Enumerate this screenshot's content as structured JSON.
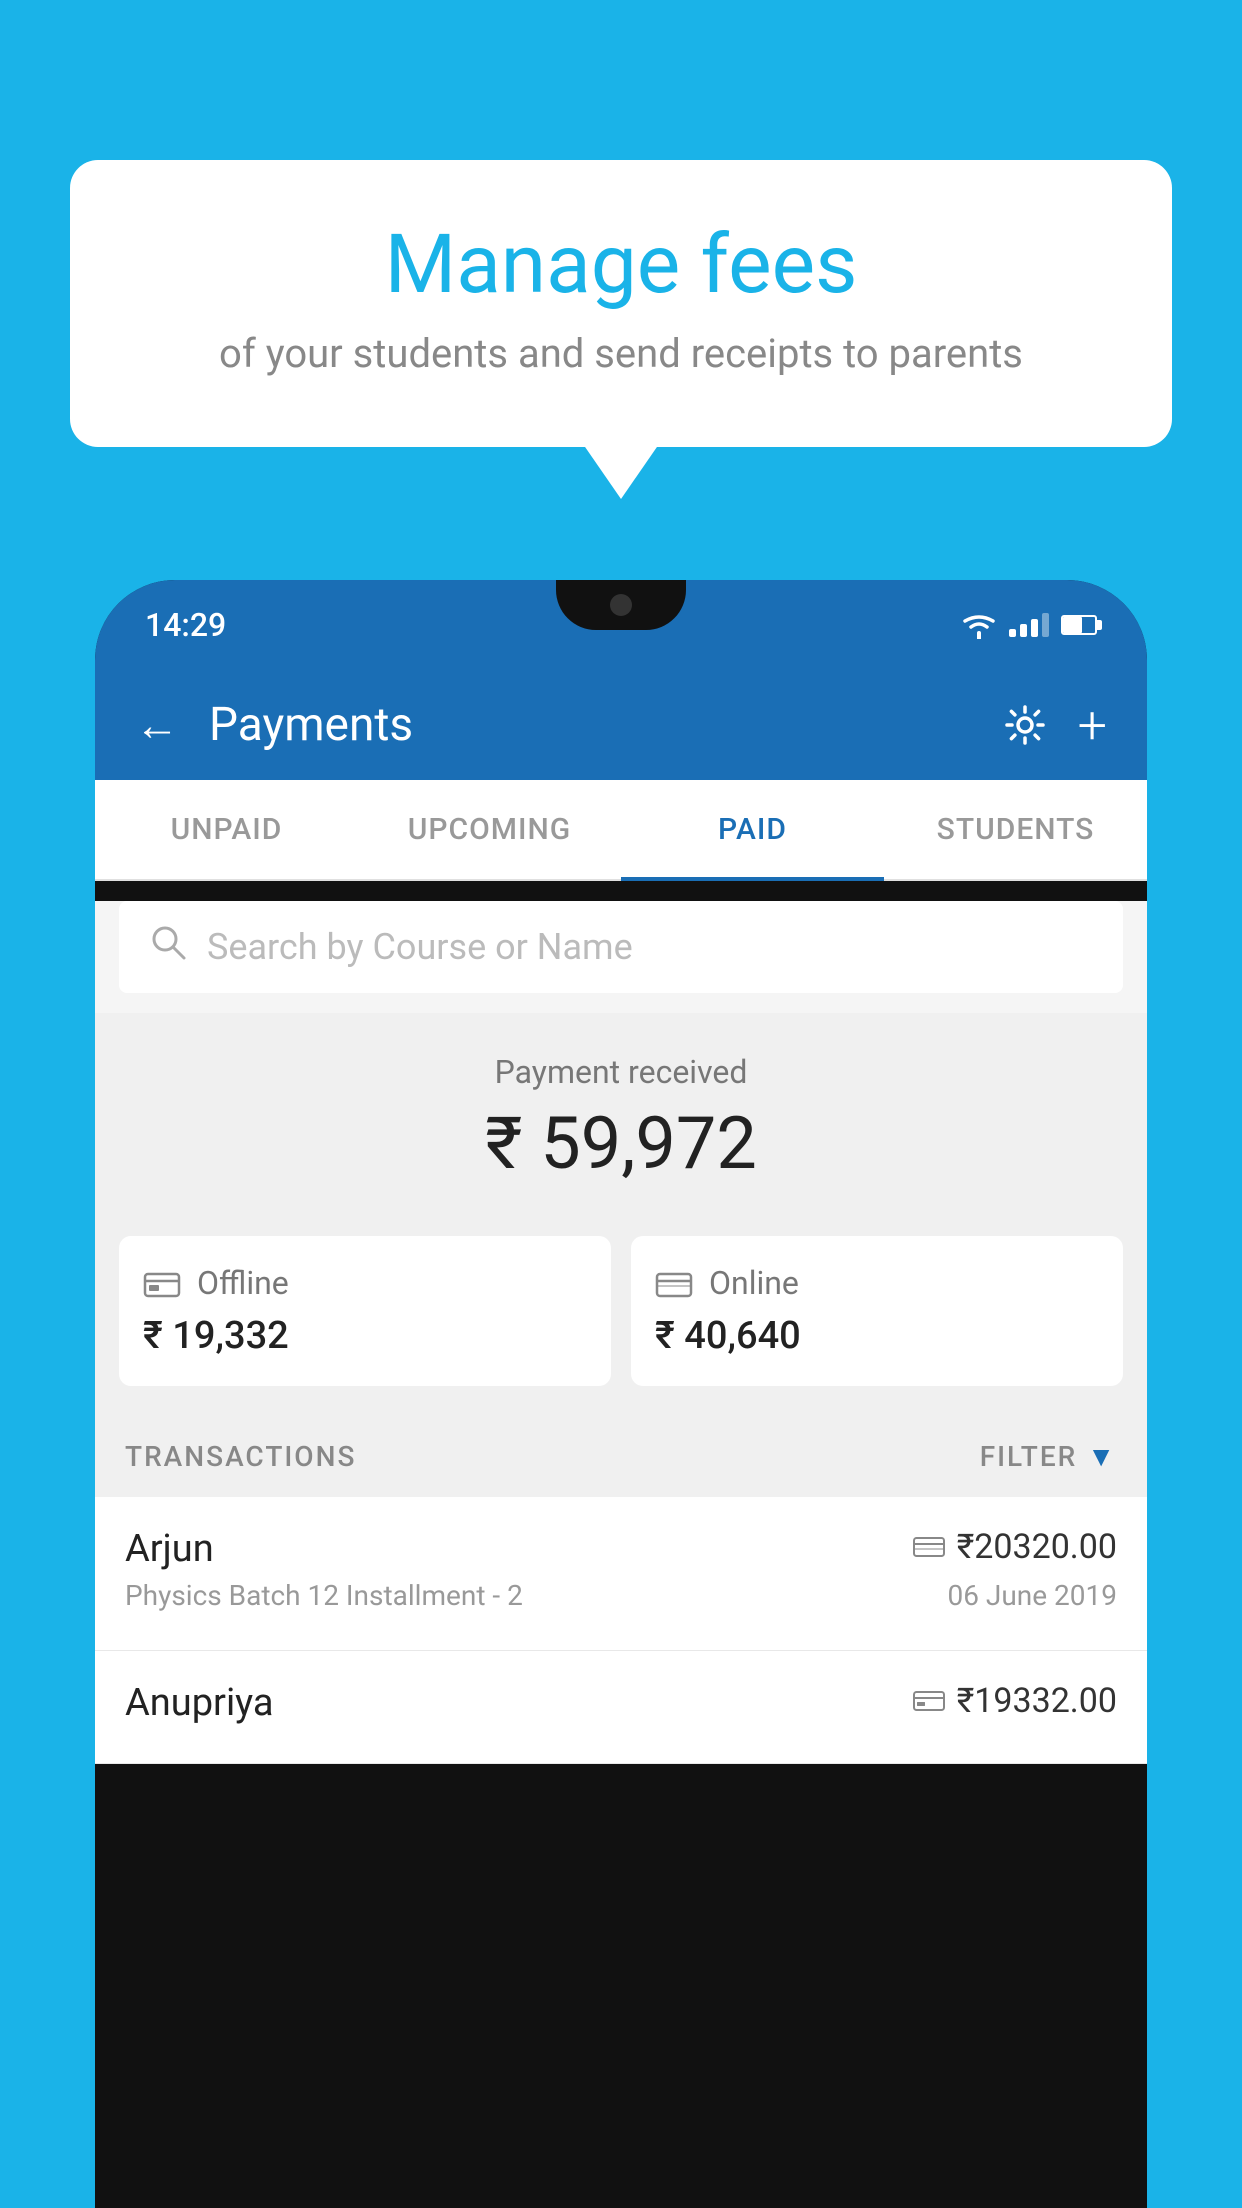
{
  "background_color": "#1ab3e8",
  "bubble": {
    "title": "Manage fees",
    "subtitle": "of your students and send receipts to parents"
  },
  "phone": {
    "status_bar": {
      "time": "14:29"
    },
    "app_bar": {
      "title": "Payments",
      "back_icon": "←",
      "gear_icon": "⚙",
      "plus_icon": "+"
    },
    "tabs": [
      {
        "label": "UNPAID",
        "active": false
      },
      {
        "label": "UPCOMING",
        "active": false
      },
      {
        "label": "PAID",
        "active": true
      },
      {
        "label": "STUDENTS",
        "active": false
      }
    ],
    "search": {
      "placeholder": "Search by Course or Name"
    },
    "payment_summary": {
      "label": "Payment received",
      "amount": "₹ 59,972",
      "offline_label": "Offline",
      "offline_amount": "₹ 19,332",
      "online_label": "Online",
      "online_amount": "₹ 40,640"
    },
    "transactions": {
      "header_label": "TRANSACTIONS",
      "filter_label": "FILTER",
      "items": [
        {
          "name": "Arjun",
          "course": "Physics Batch 12 Installment - 2",
          "amount": "₹20320.00",
          "date": "06 June 2019",
          "payment_type": "card"
        },
        {
          "name": "Anupriya",
          "course": "",
          "amount": "₹19332.00",
          "date": "",
          "payment_type": "offline"
        }
      ]
    }
  }
}
